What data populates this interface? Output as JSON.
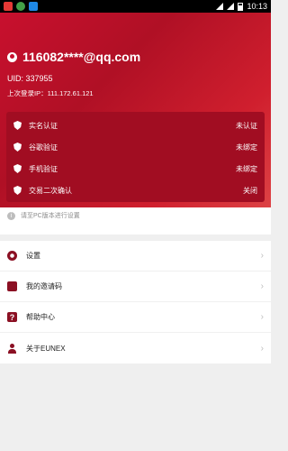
{
  "status_bar": {
    "time": "10:13"
  },
  "account": {
    "email": "116082****@qq.com",
    "uid": "UID: 337955",
    "last_login": "上次登录IP：111.172.61.121"
  },
  "security": {
    "items": [
      {
        "label": "实名认证",
        "status": "未认证"
      },
      {
        "label": "谷歌验证",
        "status": "未绑定"
      },
      {
        "label": "手机验证",
        "status": "未绑定"
      },
      {
        "label": "交易二次确认",
        "status": "关闭"
      }
    ]
  },
  "notice": "请至PC版本进行设置",
  "menu": {
    "items": [
      {
        "label": "设置",
        "icon": "gear-icon"
      },
      {
        "label": "我的邀请码",
        "icon": "invite-icon"
      },
      {
        "label": "帮助中心",
        "icon": "help-icon"
      },
      {
        "label": "关于EUNEX",
        "icon": "user-icon"
      }
    ],
    "chevron": "›"
  },
  "colors": {
    "brand": "#c8102e",
    "card": "#a10d22",
    "icon": "#8b1023"
  }
}
